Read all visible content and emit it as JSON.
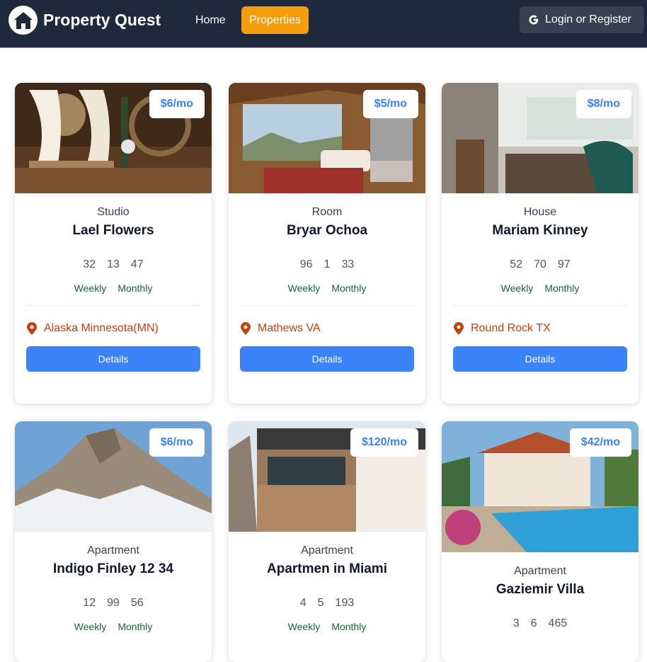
{
  "nav": {
    "brand": "Property Quest",
    "links": [
      "Home",
      "Properties"
    ],
    "login": "Login or Register"
  },
  "colors": {
    "navbar": "#1e293b",
    "accent": "#f59e0b",
    "price": "#3b82f6",
    "location": "#c2410c",
    "rates": "#166534"
  },
  "cards": [
    {
      "price": "$6/mo",
      "type": "Studio",
      "name": "Lael Flowers",
      "nums": [
        "32",
        "13",
        "47"
      ],
      "weekly": "Weekly",
      "monthly": "Monthly",
      "location": "Alaska Minnesota(MN)",
      "button": "Details",
      "image": "rustic-wedding-decor-photo"
    },
    {
      "price": "$5/mo",
      "type": "Room",
      "name": "Bryar Ochoa",
      "nums": [
        "96",
        "1",
        "33"
      ],
      "weekly": "Weekly",
      "monthly": "Monthly",
      "location": "Mathews VA",
      "button": "Details",
      "image": "cabin-living-room-photo"
    },
    {
      "price": "$8/mo",
      "type": "House",
      "name": "Mariam Kinney",
      "nums": [
        "52",
        "70",
        "97"
      ],
      "weekly": "Weekly",
      "monthly": "Monthly",
      "location": "Round Rock TX",
      "button": "Details",
      "image": "cafe-interior-photo"
    },
    {
      "price": "$6/mo",
      "type": "Apartment",
      "name": "Indigo Finley 12 34",
      "nums": [
        "12",
        "99",
        "56"
      ],
      "weekly": "Weekly",
      "monthly": "Monthly",
      "image": "snowy-mountain-photo"
    },
    {
      "price": "$120/mo",
      "type": "Apartment",
      "name": "Apartmen in Miami",
      "nums": [
        "4",
        "5",
        "193"
      ],
      "weekly": "Weekly",
      "monthly": "Monthly",
      "image": "modern-building-photo"
    },
    {
      "price": "$42/mo",
      "type": "Apartment",
      "name": "Gaziemir Villa",
      "nums": [
        "3",
        "6",
        "465"
      ],
      "image": "villa-pool-photo"
    }
  ]
}
